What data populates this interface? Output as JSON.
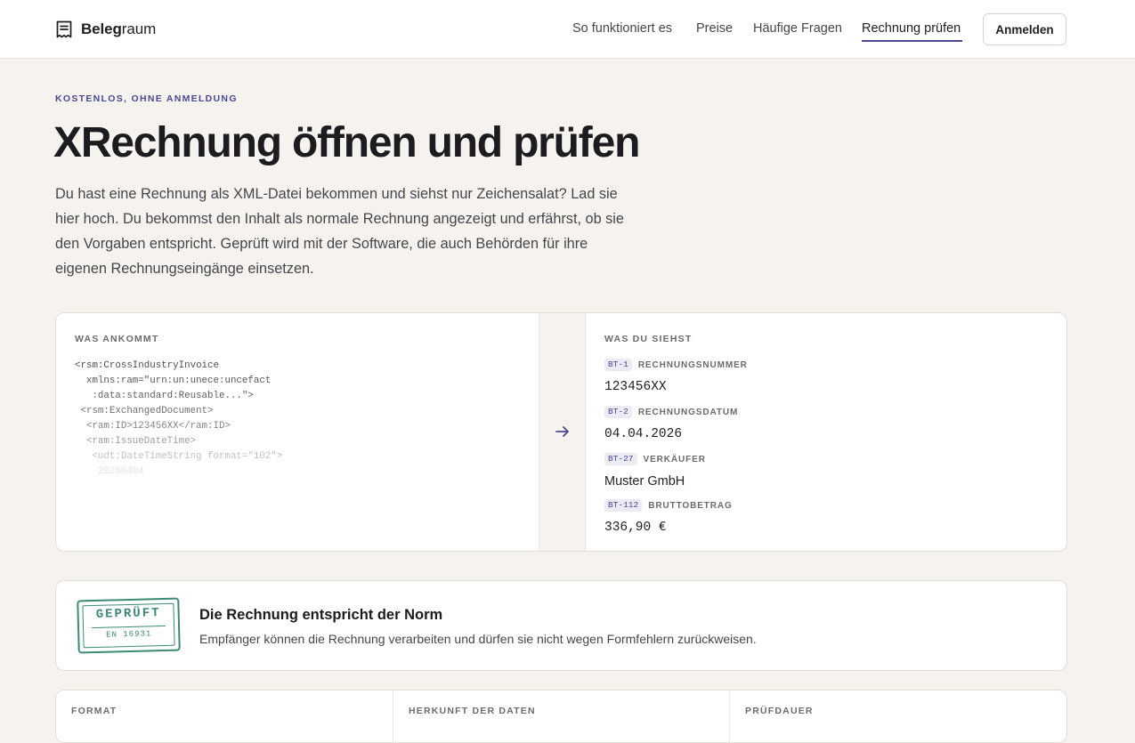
{
  "brand": {
    "name_bold": "Beleg",
    "name_rest": "raum",
    "icon": "receipt-icon"
  },
  "nav": {
    "items": [
      {
        "label": "So funktioniert es"
      },
      {
        "label": "Preise"
      },
      {
        "label": "Häufige Fragen"
      },
      {
        "label": "Rechnung prüfen",
        "active": true
      }
    ],
    "login_label": "Anmelden"
  },
  "hero": {
    "eyebrow": "KOSTENLOS, OHNE ANMELDUNG",
    "title": "XRechnung öffnen und prüfen",
    "lead": "Du hast eine Rechnung als XML-Datei bekommen und siehst nur Zeichensalat? Lad sie hier hoch. Du bekommst den Inhalt als normale Rechnung angezeigt und erfährst, ob sie den Vorgaben entspricht. Geprüft wird mit der Software, die auch Behörden für ihre eigenen Rechnungseingänge einsetzen."
  },
  "compare": {
    "left_label": "WAS ANKOMMT",
    "code_lines": [
      "<rsm:CrossIndustryInvoice",
      "  xmlns:ram=\"urn:un:unece:uncefact",
      "   :data:standard:Reusable...\">",
      " <rsm:ExchangedDocument>",
      "  <ram:ID>123456XX</ram:ID>",
      "  <ram:IssueDateTime>",
      "   <udt:DateTimeString format=\"102\">",
      "    20260404"
    ],
    "arrow_icon": "arrow-right-icon",
    "right_label": "WAS DU SIEHST",
    "fields": [
      {
        "tag": "BT-1",
        "label": "RECHNUNGSNUMMER",
        "value": "123456XX"
      },
      {
        "tag": "BT-2",
        "label": "RECHNUNGSDATUM",
        "value": "04.04.2026"
      },
      {
        "tag": "BT-27",
        "label": "VERKÄUFER",
        "value": "Muster GmbH"
      },
      {
        "tag": "BT-112",
        "label": "BRUTTOBETRAG",
        "value": "336,90 €"
      }
    ]
  },
  "result": {
    "stamp_top": "GEPRÜFT",
    "stamp_bottom": "EN 16931",
    "title": "Die Rechnung entspricht der Norm",
    "text": "Empfänger können die Rechnung verarbeiten und dürfen sie nicht wegen Formfehlern zurückweisen."
  },
  "info": {
    "columns": [
      {
        "label": "FORMAT"
      },
      {
        "label": "HERKUNFT DER DATEN"
      },
      {
        "label": "PRÜFDAUER"
      }
    ]
  },
  "colors": {
    "accent": "#4a4894",
    "stamp": "#3c8a72",
    "background": "#f6f3ee"
  }
}
